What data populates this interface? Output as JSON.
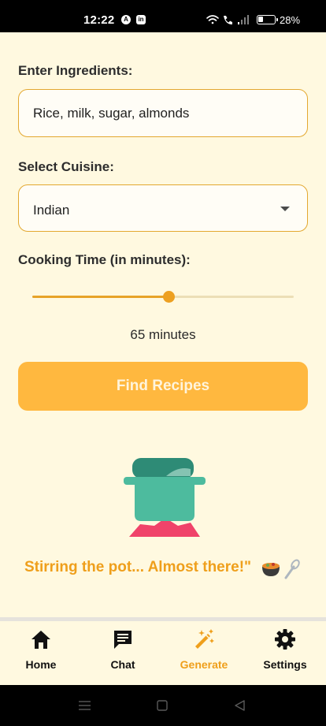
{
  "status_bar": {
    "time": "12:22",
    "app_icon_1": "A",
    "app_icon_2": "in",
    "battery_percent": "28%"
  },
  "form": {
    "ingredients_label": "Enter Ingredients:",
    "ingredients_value": "Rice, milk, sugar, almonds",
    "cuisine_label": "Select Cuisine:",
    "cuisine_selected": "Indian",
    "time_label": "Cooking Time (in minutes):",
    "time_slider_fraction": 0.52,
    "time_value_text": "65 minutes",
    "find_button": "Find Recipes"
  },
  "loading": {
    "message": "Stirring the pot... Almost there!\""
  },
  "bottom_nav": {
    "items": [
      {
        "label": "Home",
        "icon": "home-icon"
      },
      {
        "label": "Chat",
        "icon": "chat-icon"
      },
      {
        "label": "Generate",
        "icon": "magic-wand-icon",
        "active": true
      },
      {
        "label": "Settings",
        "icon": "gear-icon"
      }
    ]
  },
  "colors": {
    "accent": "#ef9f1b",
    "button": "#ffb83f",
    "background": "#fff9e0",
    "pot_body": "#4dbb9e",
    "pot_lid": "#2e8b76",
    "flame": "#f0436a"
  }
}
